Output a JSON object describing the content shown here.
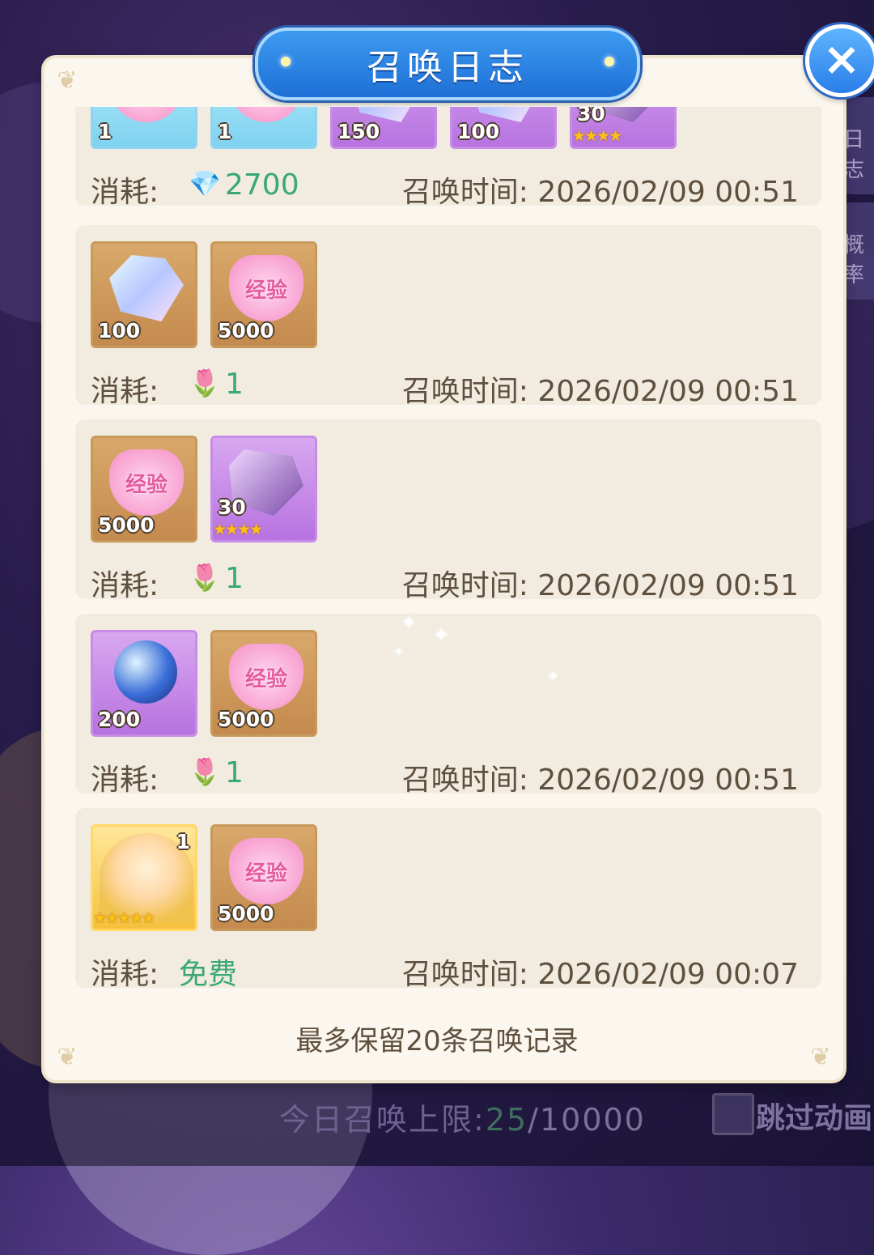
{
  "dialog": {
    "title": "召唤日志",
    "close_icon": "close-icon",
    "footer_note": "最多保留20条召唤记录"
  },
  "labels": {
    "cost": "消耗:",
    "summon_time": "召唤时间:"
  },
  "entries": [
    {
      "items": [
        {
          "type": "pink-hearts",
          "style": "cyan",
          "count": "1"
        },
        {
          "type": "pink-hearts",
          "style": "cyan",
          "count": "1"
        },
        {
          "type": "item",
          "style": "purple",
          "count": "150"
        },
        {
          "type": "item",
          "style": "purple",
          "count": "100"
        },
        {
          "type": "purple-gem",
          "style": "purple",
          "count": "30",
          "stars": 4
        }
      ],
      "cost_icon": "diamond-icon",
      "cost_value": "2700",
      "time": "2026/02/09 00:51"
    },
    {
      "items": [
        {
          "type": "rainbow-crystal",
          "style": "gold",
          "count": "100"
        },
        {
          "type": "exp-heart",
          "style": "gold",
          "count": "5000",
          "label": "经验"
        }
      ],
      "cost_icon": "flower-icon",
      "cost_value": "1",
      "time": "2026/02/09 00:51"
    },
    {
      "items": [
        {
          "type": "exp-heart",
          "style": "gold",
          "count": "5000",
          "label": "经验"
        },
        {
          "type": "purple-gem",
          "style": "purple",
          "count": "30",
          "stars": 4
        }
      ],
      "cost_icon": "flower-icon",
      "cost_value": "1",
      "time": "2026/02/09 00:51"
    },
    {
      "items": [
        {
          "type": "star-orb",
          "style": "purple",
          "count": "200"
        },
        {
          "type": "exp-heart",
          "style": "gold",
          "count": "5000",
          "label": "经验"
        }
      ],
      "cost_icon": "flower-icon",
      "cost_value": "1",
      "time": "2026/02/09 00:51"
    },
    {
      "items": [
        {
          "type": "character-portrait",
          "style": "char",
          "count": "1",
          "stars": 5
        },
        {
          "type": "exp-heart",
          "style": "gold",
          "count": "5000",
          "label": "经验"
        }
      ],
      "cost_icon": "",
      "cost_value": "免费",
      "time": "2026/02/09 00:07"
    }
  ],
  "background": {
    "daily_limit_label": "今日召唤上限:",
    "daily_limit_used": "25",
    "daily_limit_total": "/10000",
    "skip_animation_label": "跳过动画",
    "side_tabs": [
      "日志",
      "概率"
    ]
  }
}
